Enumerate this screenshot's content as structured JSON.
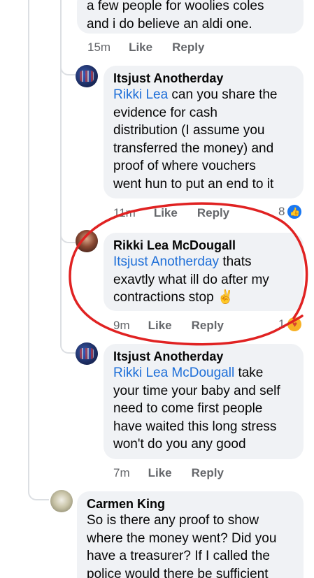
{
  "comments": [
    {
      "id": "top-partial",
      "text_lines": [
        "a few people for woolies coles",
        "and i do believe an aldi one."
      ],
      "time": "15m",
      "like_label": "Like",
      "reply_label": "Reply"
    },
    {
      "id": "itsjust-1",
      "author": "Itsjust Anotherday",
      "mention": "Rikki Lea",
      "text_after_mention": " can you share the",
      "text_lines": [
        "evidence for cash",
        "distribution (I assume you",
        "transferred the money) and",
        "proof of where vouchers",
        "went hun to put an end to it"
      ],
      "time": "11m",
      "like_label": "Like",
      "reply_label": "Reply",
      "reaction_count": "8",
      "reaction_icon": "like-icon"
    },
    {
      "id": "rikki-1",
      "author": "Rikki Lea McDougall",
      "mention": "Itsjust Anotherday",
      "text_after_mention": " thats",
      "text_lines": [
        "exavtly what ill do after my",
        "contractions stop"
      ],
      "emoji": "✌️",
      "time": "9m",
      "like_label": "Like",
      "reply_label": "Reply",
      "reaction_count": "1",
      "reaction_icon": "care-icon"
    },
    {
      "id": "itsjust-2",
      "author": "Itsjust Anotherday",
      "mention": "Rikki Lea McDougall",
      "text_after_mention": " take",
      "text_lines": [
        "your time your baby and self",
        "need to come first people",
        "have waited this long stress",
        "won't do you any good"
      ],
      "time": "7m",
      "like_label": "Like",
      "reply_label": "Reply"
    },
    {
      "id": "carmen-1",
      "author": "Carmen King",
      "text_lines": [
        "So is there any proof to show",
        "where the money went? Did you",
        "have a treasurer? If I called the",
        "police would there be sufficient"
      ]
    }
  ],
  "colors": {
    "bubble": "#f0f2f5",
    "mention": "#1d6ed8",
    "meta": "#65676b",
    "annotation": "#e02222"
  }
}
